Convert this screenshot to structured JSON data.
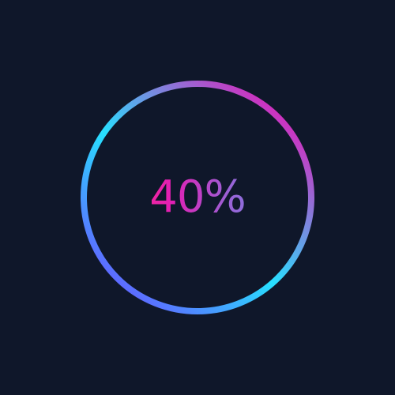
{
  "progress": {
    "value": 0.4,
    "label": "40%"
  },
  "colors": {
    "background": "#0F172A",
    "ring_stops": [
      "#EE0FB3",
      "#27E0FF",
      "#6B4DFF"
    ],
    "text_stops": [
      "#FF2E8A",
      "#E21FB4",
      "#9A62D6",
      "#7A86E8"
    ]
  }
}
